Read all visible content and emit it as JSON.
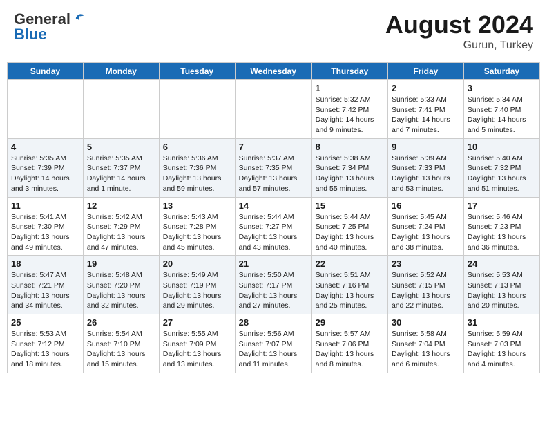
{
  "header": {
    "logo_general": "General",
    "logo_blue": "Blue",
    "month_year": "August 2024",
    "location": "Gurun, Turkey"
  },
  "days_of_week": [
    "Sunday",
    "Monday",
    "Tuesday",
    "Wednesday",
    "Thursday",
    "Friday",
    "Saturday"
  ],
  "weeks": [
    [
      {
        "day": "",
        "info": ""
      },
      {
        "day": "",
        "info": ""
      },
      {
        "day": "",
        "info": ""
      },
      {
        "day": "",
        "info": ""
      },
      {
        "day": "1",
        "info": "Sunrise: 5:32 AM\nSunset: 7:42 PM\nDaylight: 14 hours\nand 9 minutes."
      },
      {
        "day": "2",
        "info": "Sunrise: 5:33 AM\nSunset: 7:41 PM\nDaylight: 14 hours\nand 7 minutes."
      },
      {
        "day": "3",
        "info": "Sunrise: 5:34 AM\nSunset: 7:40 PM\nDaylight: 14 hours\nand 5 minutes."
      }
    ],
    [
      {
        "day": "4",
        "info": "Sunrise: 5:35 AM\nSunset: 7:39 PM\nDaylight: 14 hours\nand 3 minutes."
      },
      {
        "day": "5",
        "info": "Sunrise: 5:35 AM\nSunset: 7:37 PM\nDaylight: 14 hours\nand 1 minute."
      },
      {
        "day": "6",
        "info": "Sunrise: 5:36 AM\nSunset: 7:36 PM\nDaylight: 13 hours\nand 59 minutes."
      },
      {
        "day": "7",
        "info": "Sunrise: 5:37 AM\nSunset: 7:35 PM\nDaylight: 13 hours\nand 57 minutes."
      },
      {
        "day": "8",
        "info": "Sunrise: 5:38 AM\nSunset: 7:34 PM\nDaylight: 13 hours\nand 55 minutes."
      },
      {
        "day": "9",
        "info": "Sunrise: 5:39 AM\nSunset: 7:33 PM\nDaylight: 13 hours\nand 53 minutes."
      },
      {
        "day": "10",
        "info": "Sunrise: 5:40 AM\nSunset: 7:32 PM\nDaylight: 13 hours\nand 51 minutes."
      }
    ],
    [
      {
        "day": "11",
        "info": "Sunrise: 5:41 AM\nSunset: 7:30 PM\nDaylight: 13 hours\nand 49 minutes."
      },
      {
        "day": "12",
        "info": "Sunrise: 5:42 AM\nSunset: 7:29 PM\nDaylight: 13 hours\nand 47 minutes."
      },
      {
        "day": "13",
        "info": "Sunrise: 5:43 AM\nSunset: 7:28 PM\nDaylight: 13 hours\nand 45 minutes."
      },
      {
        "day": "14",
        "info": "Sunrise: 5:44 AM\nSunset: 7:27 PM\nDaylight: 13 hours\nand 43 minutes."
      },
      {
        "day": "15",
        "info": "Sunrise: 5:44 AM\nSunset: 7:25 PM\nDaylight: 13 hours\nand 40 minutes."
      },
      {
        "day": "16",
        "info": "Sunrise: 5:45 AM\nSunset: 7:24 PM\nDaylight: 13 hours\nand 38 minutes."
      },
      {
        "day": "17",
        "info": "Sunrise: 5:46 AM\nSunset: 7:23 PM\nDaylight: 13 hours\nand 36 minutes."
      }
    ],
    [
      {
        "day": "18",
        "info": "Sunrise: 5:47 AM\nSunset: 7:21 PM\nDaylight: 13 hours\nand 34 minutes."
      },
      {
        "day": "19",
        "info": "Sunrise: 5:48 AM\nSunset: 7:20 PM\nDaylight: 13 hours\nand 32 minutes."
      },
      {
        "day": "20",
        "info": "Sunrise: 5:49 AM\nSunset: 7:19 PM\nDaylight: 13 hours\nand 29 minutes."
      },
      {
        "day": "21",
        "info": "Sunrise: 5:50 AM\nSunset: 7:17 PM\nDaylight: 13 hours\nand 27 minutes."
      },
      {
        "day": "22",
        "info": "Sunrise: 5:51 AM\nSunset: 7:16 PM\nDaylight: 13 hours\nand 25 minutes."
      },
      {
        "day": "23",
        "info": "Sunrise: 5:52 AM\nSunset: 7:15 PM\nDaylight: 13 hours\nand 22 minutes."
      },
      {
        "day": "24",
        "info": "Sunrise: 5:53 AM\nSunset: 7:13 PM\nDaylight: 13 hours\nand 20 minutes."
      }
    ],
    [
      {
        "day": "25",
        "info": "Sunrise: 5:53 AM\nSunset: 7:12 PM\nDaylight: 13 hours\nand 18 minutes."
      },
      {
        "day": "26",
        "info": "Sunrise: 5:54 AM\nSunset: 7:10 PM\nDaylight: 13 hours\nand 15 minutes."
      },
      {
        "day": "27",
        "info": "Sunrise: 5:55 AM\nSunset: 7:09 PM\nDaylight: 13 hours\nand 13 minutes."
      },
      {
        "day": "28",
        "info": "Sunrise: 5:56 AM\nSunset: 7:07 PM\nDaylight: 13 hours\nand 11 minutes."
      },
      {
        "day": "29",
        "info": "Sunrise: 5:57 AM\nSunset: 7:06 PM\nDaylight: 13 hours\nand 8 minutes."
      },
      {
        "day": "30",
        "info": "Sunrise: 5:58 AM\nSunset: 7:04 PM\nDaylight: 13 hours\nand 6 minutes."
      },
      {
        "day": "31",
        "info": "Sunrise: 5:59 AM\nSunset: 7:03 PM\nDaylight: 13 hours\nand 4 minutes."
      }
    ]
  ]
}
